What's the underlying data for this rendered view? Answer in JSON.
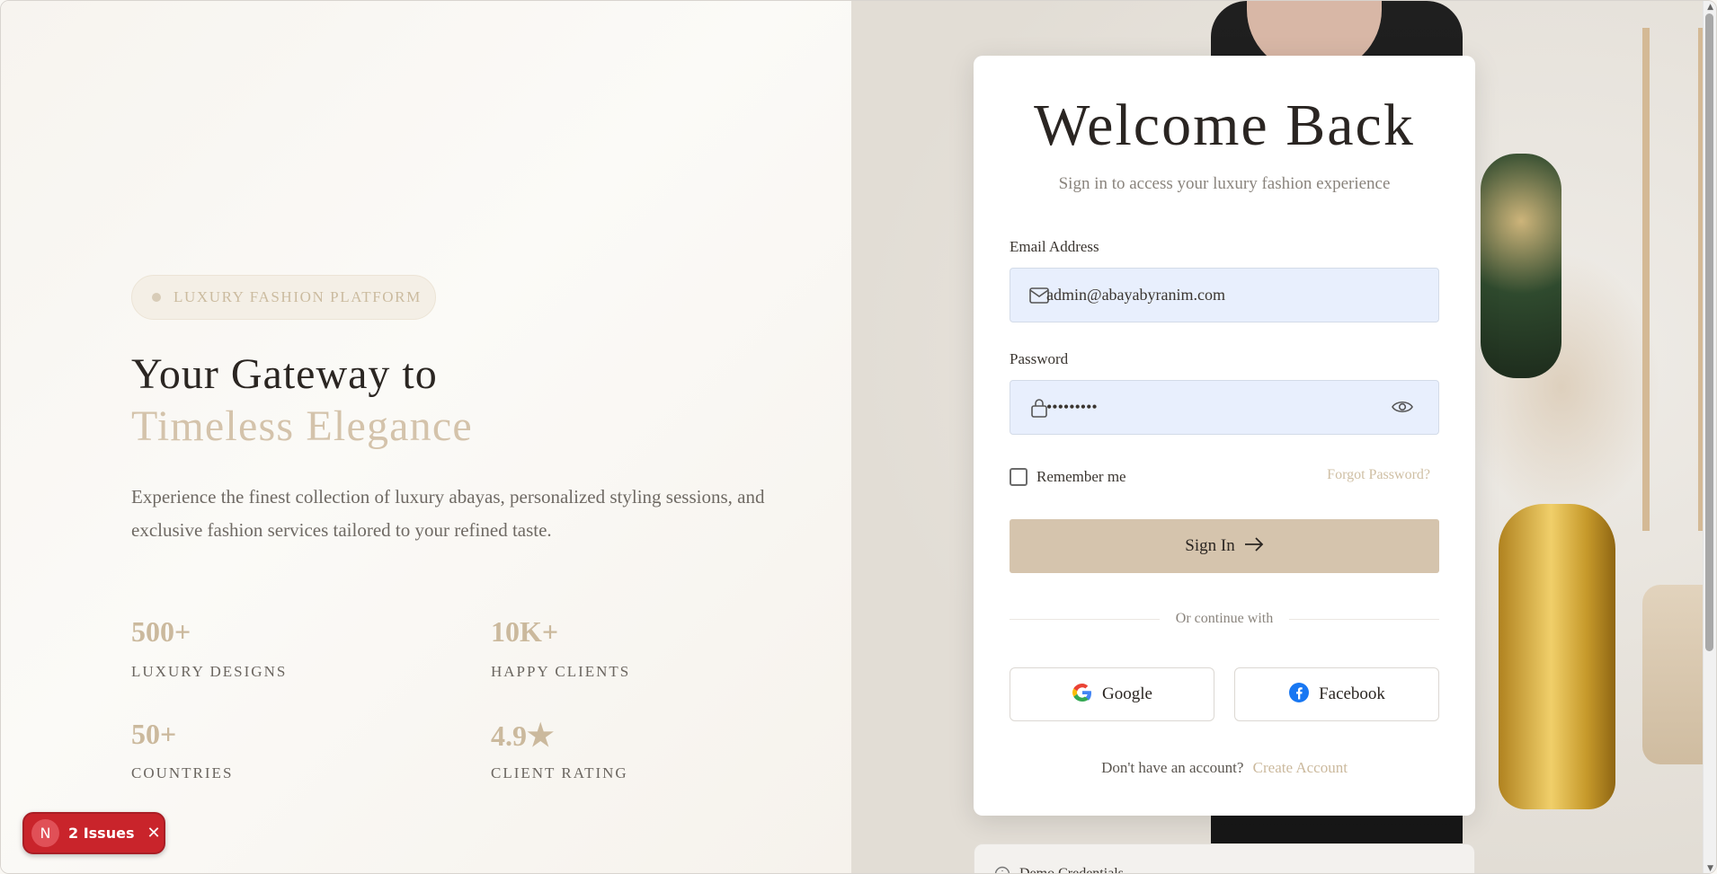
{
  "hero": {
    "badge": "LUXURY FASHION PLATFORM",
    "headline_line1": "Your Gateway to",
    "headline_line2": "Timeless Elegance",
    "description": "Experience the finest collection of luxury abayas, personalized styling sessions, and exclusive fashion services tailored to your refined taste."
  },
  "stats": [
    {
      "value": "500+",
      "label": "LUXURY DESIGNS"
    },
    {
      "value": "10K+",
      "label": "HAPPY CLIENTS"
    },
    {
      "value": "50+",
      "label": "COUNTRIES"
    },
    {
      "value": "4.9",
      "label": "CLIENT RATING"
    }
  ],
  "issues_badge": {
    "initial": "N",
    "label": "2 Issues"
  },
  "login": {
    "title": "Welcome Back",
    "subtitle": "Sign in to access your luxury fashion experience",
    "email_label": "Email Address",
    "email_value": "admin@abayabyranim.com",
    "password_label": "Password",
    "password_value": "•••••••••",
    "remember_label": "Remember me",
    "forgot_label": "Forgot Password?",
    "signin_label": "Sign In",
    "divider_text": "Or continue with",
    "google_label": "Google",
    "facebook_label": "Facebook",
    "signup_prompt": "Don't have an account?",
    "signup_link": "Create Account"
  },
  "demo": {
    "label": "Demo Credentials"
  },
  "colors": {
    "accent": "#d5c4ad",
    "accent_text": "#cbb99d",
    "field_bg": "#e8effd",
    "issues_red": "#c9242b"
  },
  "icons": [
    "mail-icon",
    "lock-icon",
    "eye-icon",
    "arrow-right-icon",
    "google-icon",
    "facebook-icon",
    "info-icon",
    "close-icon",
    "star-icon"
  ]
}
